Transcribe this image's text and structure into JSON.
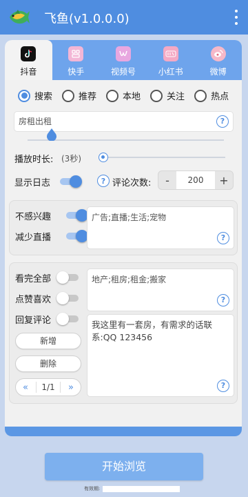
{
  "app": {
    "title": "飞鱼(v1.0.0.0)"
  },
  "tabs": [
    {
      "label": "抖音",
      "icon": "douyin-icon",
      "active": true
    },
    {
      "label": "快手",
      "icon": "kuaishou-icon",
      "active": false
    },
    {
      "label": "视频号",
      "icon": "shipinhao-icon",
      "active": false
    },
    {
      "label": "小红书",
      "icon": "xiaohongshu-icon",
      "active": false
    },
    {
      "label": "微博",
      "icon": "weibo-icon",
      "active": false
    }
  ],
  "modes": {
    "options": [
      "搜索",
      "推荐",
      "本地",
      "关注",
      "热点"
    ],
    "selected": "搜索"
  },
  "keyword": {
    "value": "房租出租"
  },
  "play_duration": {
    "label": "播放时长:",
    "value": "(3秒)"
  },
  "show_log": {
    "label": "显示日志",
    "on": true
  },
  "comment_count": {
    "label": "评论次数:",
    "value": "200",
    "minus": "-",
    "plus": "+"
  },
  "interest": {
    "not_interested": {
      "label": "不感兴趣",
      "on": true
    },
    "less_live": {
      "label": "减少直播",
      "on": true
    },
    "keywords": "广告;直播;生活;宠物"
  },
  "actions": {
    "watch_all": {
      "label": "看完全部",
      "on": false
    },
    "like": {
      "label": "点赞喜欢",
      "on": false
    },
    "reply": {
      "label": "回复评论",
      "on": false
    },
    "match_keywords": "地产;租房;租金;搬家",
    "reply_text": "我这里有一套房，有需求的话联系:QQ 123456",
    "add_button": "新增",
    "delete_button": "删除",
    "pager": {
      "prev": "«",
      "page": "1/1",
      "next": "»"
    }
  },
  "start_button": "开始浏览",
  "validity_label": "有效期:",
  "colors": {
    "primary": "#4f8de0",
    "tab_bar": "#6ea4ec",
    "start": "#7db0ee"
  }
}
